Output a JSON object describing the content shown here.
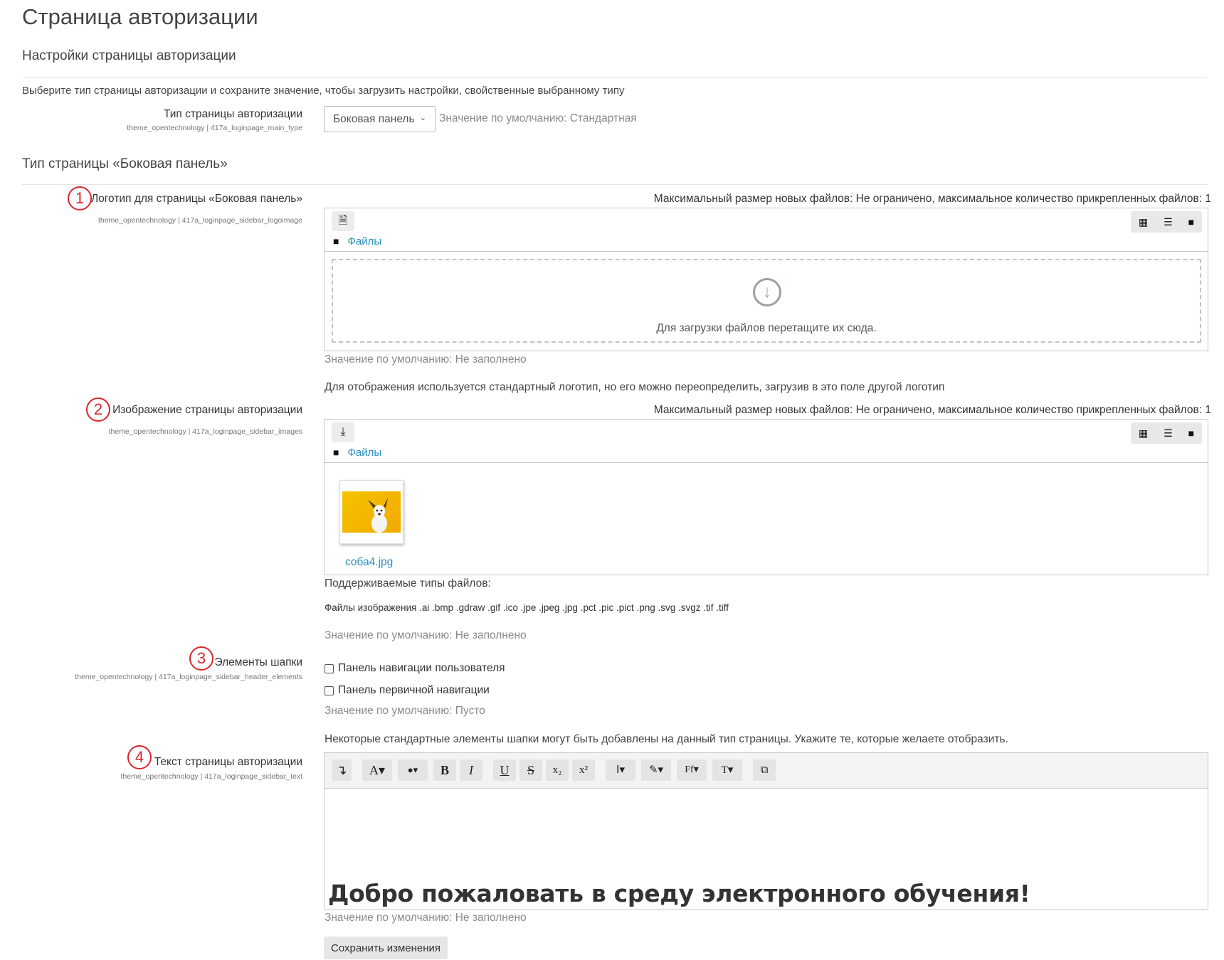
{
  "page_title": "Страница авторизации",
  "settings_section": {
    "title": "Настройки страницы авторизации",
    "description": "Выберите тип страницы авторизации и сохраните значение, чтобы загрузить настройки, свойственные выбранному типу",
    "main_type": {
      "label": "Тип страницы авторизации",
      "setting_id": "theme_opentechnology | 417a_loginpage_main_type",
      "selected": "Боковая панель",
      "default_text": "Значение по умолчанию: Стандартная"
    }
  },
  "sidebar_section": {
    "title": "Тип страницы «Боковая панель»",
    "logo": {
      "number": "1",
      "label": "Логотип для страницы «Боковая панель»",
      "setting_id": "theme_opentechnology | 417a_loginpage_sidebar_logoimage",
      "max_size": "Максимальный размер новых файлов: Не ограничено, максимальное количество прикрепленных файлов: 1",
      "folder_label": "Файлы",
      "drop_text": "Для загрузки файлов перетащите их сюда.",
      "default_text": "Значение по умолчанию: Не заполнено",
      "help_text": "Для отображения используется стандартный логотип, но его можно переопределить, загрузив в это поле другой логотип"
    },
    "images": {
      "number": "2",
      "label": "Изображение страницы авторизации",
      "setting_id": "theme_opentechnology | 417a_loginpage_sidebar_images",
      "max_size": "Максимальный размер новых файлов: Не ограничено, максимальное количество прикрепленных файлов: 1",
      "folder_label": "Файлы",
      "file_name": "соба4.jpg",
      "supported_title": "Поддерживаемые типы файлов:",
      "supported_list": "Файлы изображения .ai .bmp .gdraw .gif .ico .jpe .jpeg .jpg .pct .pic .pict .png .svg .svgz .tif .tiff",
      "default_text": "Значение по умолчанию: Не заполнено"
    },
    "header_elements": {
      "number": "3",
      "label": "Элементы шапки",
      "setting_id": "theme_opentechnology | 417a_loginpage_sidebar_header_elements",
      "options": [
        "Панель навигации пользователя",
        "Панель первичной навигации"
      ],
      "default_text": "Значение по умолчанию: Пусто",
      "help_text": "Некоторые стандартные элементы шапки могут быть добавлены на данный тип страницы. Укажите те, которые желаете отобразить."
    },
    "text": {
      "number": "4",
      "label": "Текст страницы авторизации",
      "setting_id": "theme_opentechnology | 417a_loginpage_sidebar_text",
      "content": "Добро пожаловать в среду электронного обучения!",
      "default_text": "Значение по умолчанию: Не заполнено"
    }
  },
  "toolbar": {
    "buttons": [
      "↴",
      "A▾",
      "●▾",
      "B",
      "I",
      "U",
      "S",
      "x₂",
      "x²",
      "Ⅰ▾",
      "✎▾",
      "Ff▾",
      "T▾",
      "⧉"
    ]
  },
  "save_button": "Сохранить изменения",
  "colors": {
    "annotation": "#d9262b",
    "link": "#2a8fbd",
    "muted": "#8a8a8a"
  },
  "icons": {
    "file_picker_add": "file-icon",
    "file_picker_download": "download-icon",
    "view_icons": "grid-icon",
    "view_list": "list-icon",
    "view_tree": "folder-icon",
    "drop_zone": "arrow-down-circle-icon"
  }
}
